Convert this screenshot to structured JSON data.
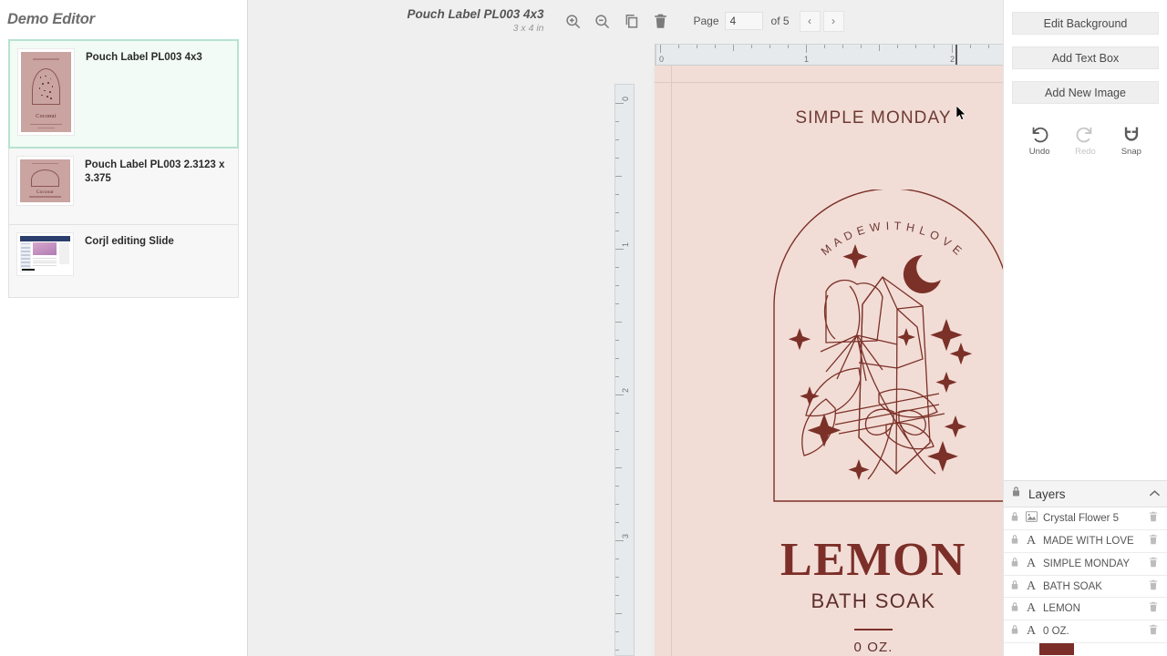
{
  "sidebar": {
    "title": "Demo Editor",
    "pages": [
      {
        "label": "Pouch Label PL003 4x3",
        "selected": true,
        "thumb": "label-arch-thumb"
      },
      {
        "label": "Pouch Label PL003 2.3123 x 3.375",
        "selected": false,
        "thumb": "label-arch-thumb"
      },
      {
        "label": "Corjl editing Slide",
        "selected": false,
        "thumb": "editor-screenshot-thumb"
      }
    ]
  },
  "toolbar": {
    "doc_title": "Pouch Label PL003 4x3",
    "doc_dimensions": "3 x 4 in",
    "icons": [
      {
        "name": "zoom-in-icon",
        "label": "Zoom In"
      },
      {
        "name": "zoom-out-icon",
        "label": "Zoom Out"
      },
      {
        "name": "duplicate-icon",
        "label": "Duplicate"
      },
      {
        "name": "trash-icon",
        "label": "Delete"
      }
    ],
    "page_label": "Page",
    "page_value": "4",
    "page_of": "of 5",
    "prev_label": "‹",
    "next_label": "›"
  },
  "rulers": {
    "horizontal_ticks": [
      "0",
      "1",
      "2"
    ],
    "vertical_ticks": [
      "0",
      "1",
      "2",
      "3"
    ],
    "unit": "in"
  },
  "artboard": {
    "background_color": "#f2ddd6",
    "ink_color": "#7b2f28",
    "texts": {
      "header": "SIMPLE MONDAY",
      "arch_curved": "MADE WITH LOVE",
      "product": "LEMON",
      "subtitle": "BATH SOAK",
      "weight": "0 OZ."
    }
  },
  "right_panel": {
    "buttons": [
      {
        "label": "Edit Background",
        "name": "edit-background-button"
      },
      {
        "label": "Add Text Box",
        "name": "add-text-box-button"
      },
      {
        "label": "Add New Image",
        "name": "add-new-image-button"
      }
    ],
    "tools": [
      {
        "label": "Undo",
        "name": "undo-tool",
        "disabled": false
      },
      {
        "label": "Redo",
        "name": "redo-tool",
        "disabled": true
      },
      {
        "label": "Snap",
        "name": "snap-tool",
        "disabled": false
      }
    ]
  },
  "layers_panel": {
    "title": "Layers",
    "collapse_glyph": "∧",
    "rows": [
      {
        "name": "Crystal Flower 5",
        "type": "image",
        "locked": false
      },
      {
        "name": "MADE WITH LOVE",
        "type": "text",
        "locked": false
      },
      {
        "name": "SIMPLE MONDAY",
        "type": "text",
        "locked": false
      },
      {
        "name": "BATH SOAK",
        "type": "text",
        "locked": false
      },
      {
        "name": "LEMON",
        "type": "text",
        "locked": false
      },
      {
        "name": "0 OZ.",
        "type": "text",
        "locked": false
      },
      {
        "name": "",
        "type": "color-swatch",
        "locked": false,
        "color": "#7b2f28"
      }
    ]
  },
  "colors": {
    "selected_outline": "#b6e3d0",
    "canvas_backdrop": "#efefef",
    "label_pink": "#f2ddd6",
    "label_maroon": "#7b2f28"
  }
}
